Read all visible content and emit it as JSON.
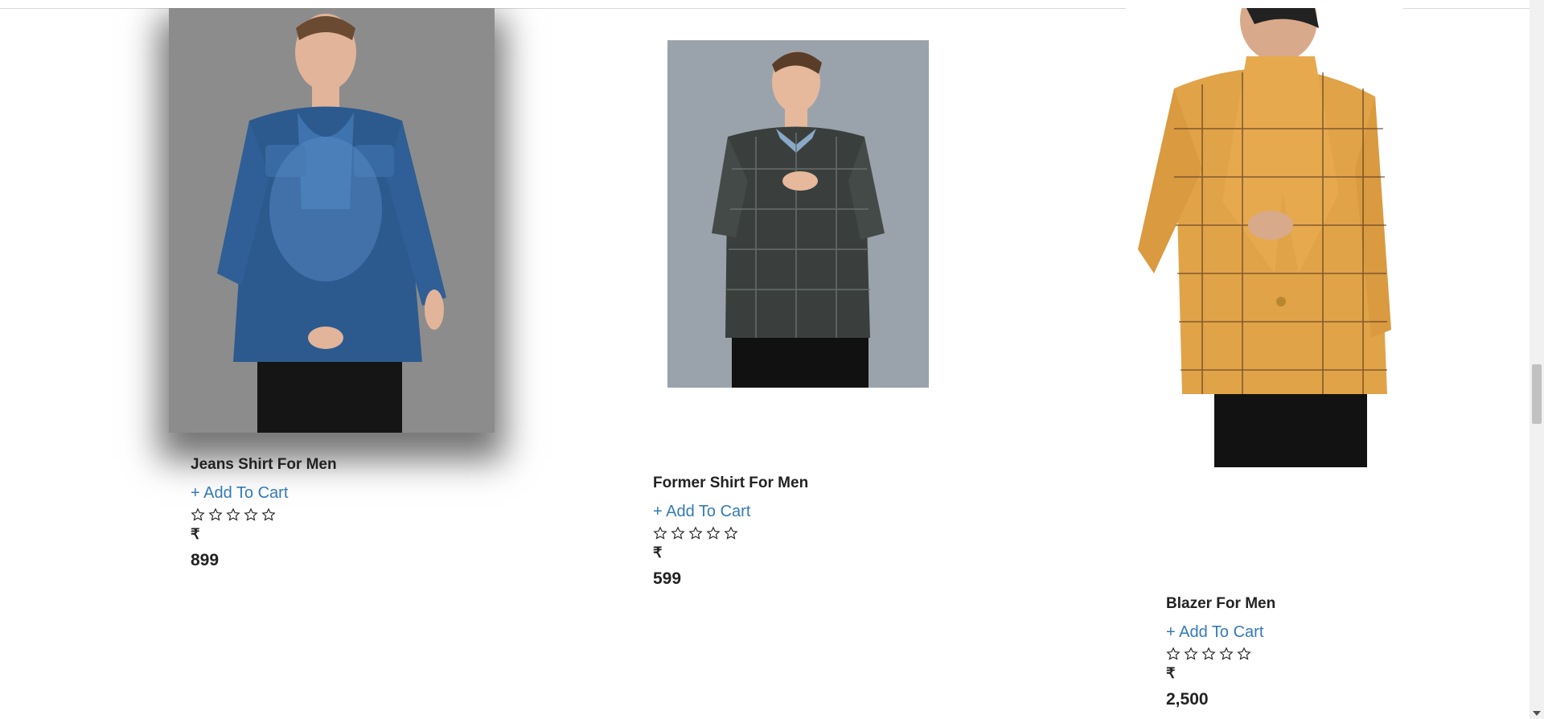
{
  "products": [
    {
      "name": "Jeans Shirt For Men",
      "add_to_cart": "+ Add To Cart",
      "currency": "₹",
      "price": "899"
    },
    {
      "name": "Former Shirt For Men",
      "add_to_cart": "+ Add To Cart",
      "currency": "₹",
      "price": "599"
    },
    {
      "name": "Blazer For Men",
      "add_to_cart": "+ Add To Cart",
      "currency": "₹",
      "price": "2,500"
    }
  ],
  "rating_icon": "star-outline-icon",
  "colors": {
    "link": "#337ab7",
    "card1_image_bg": "#8c8c8c",
    "card2_image_bg": "#9aa3ab"
  }
}
